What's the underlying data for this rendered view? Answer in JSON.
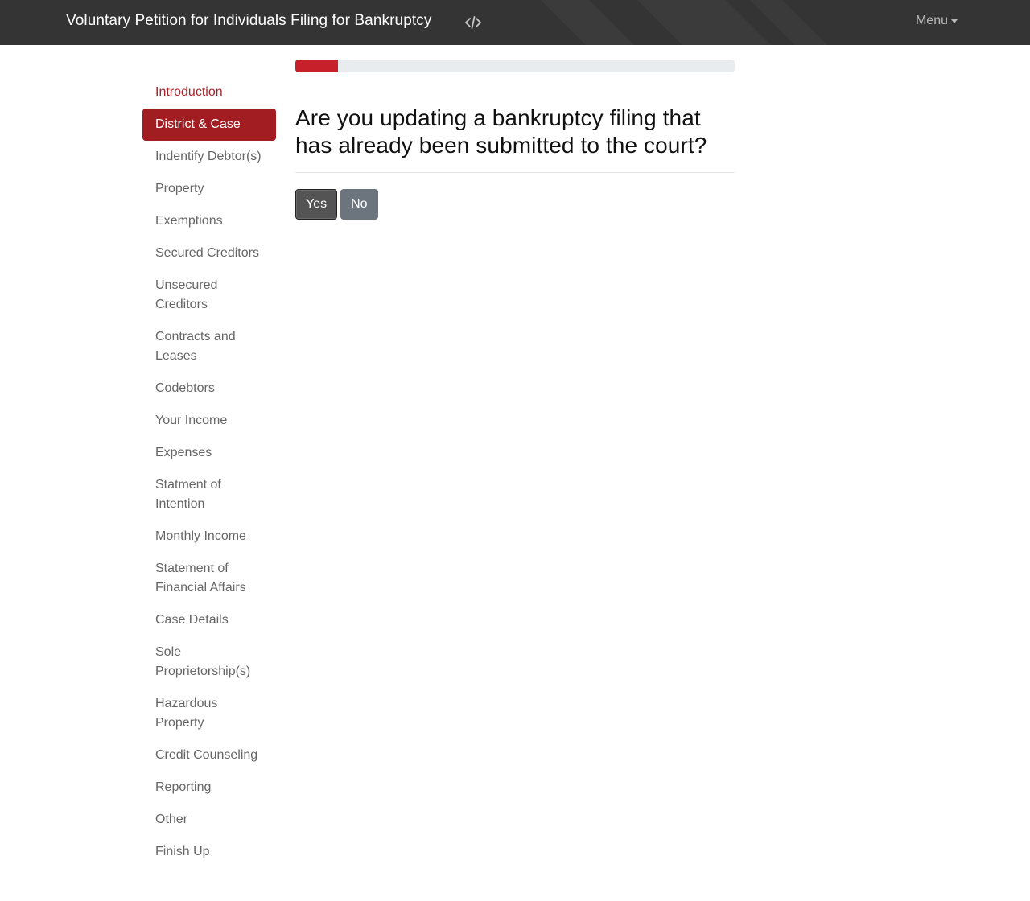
{
  "app": {
    "title": "Voluntary Petition for Individuals Filing for Bankruptcy",
    "menu_label": "Menu"
  },
  "icons": {
    "source_toggle": "code-icon",
    "menu_caret": "caret-down-icon"
  },
  "colors": {
    "navbar": "#343434",
    "accent": "#a11d21",
    "progress": "#c8202b",
    "visited_link": "#a4262c"
  },
  "sidebar": {
    "items": [
      {
        "label": "Introduction",
        "state": "visited"
      },
      {
        "label": "District & Case",
        "state": "active"
      },
      {
        "label": "Indentify Debtor(s)",
        "state": "default"
      },
      {
        "label": "Property",
        "state": "default"
      },
      {
        "label": "Exemptions",
        "state": "default"
      },
      {
        "label": "Secured Creditors",
        "state": "default"
      },
      {
        "label": "Unsecured Creditors",
        "state": "default"
      },
      {
        "label": "Contracts and Leases",
        "state": "default"
      },
      {
        "label": "Codebtors",
        "state": "default"
      },
      {
        "label": "Your Income",
        "state": "default"
      },
      {
        "label": "Expenses",
        "state": "default"
      },
      {
        "label": "Statment of Intention",
        "state": "default"
      },
      {
        "label": "Monthly Income",
        "state": "default"
      },
      {
        "label": "Statement of Financial Affairs",
        "state": "default"
      },
      {
        "label": "Case Details",
        "state": "default"
      },
      {
        "label": "Sole Proprietorship(s)",
        "state": "default"
      },
      {
        "label": "Hazardous Property",
        "state": "default"
      },
      {
        "label": "Credit Counseling",
        "state": "default"
      },
      {
        "label": "Reporting",
        "state": "default"
      },
      {
        "label": "Other",
        "state": "default"
      },
      {
        "label": "Finish Up",
        "state": "default"
      }
    ]
  },
  "main": {
    "progress_percent": 9.7,
    "question": "Are you updating a bankruptcy filing that has already been submitted to the court?",
    "yes_label": "Yes",
    "no_label": "No"
  }
}
